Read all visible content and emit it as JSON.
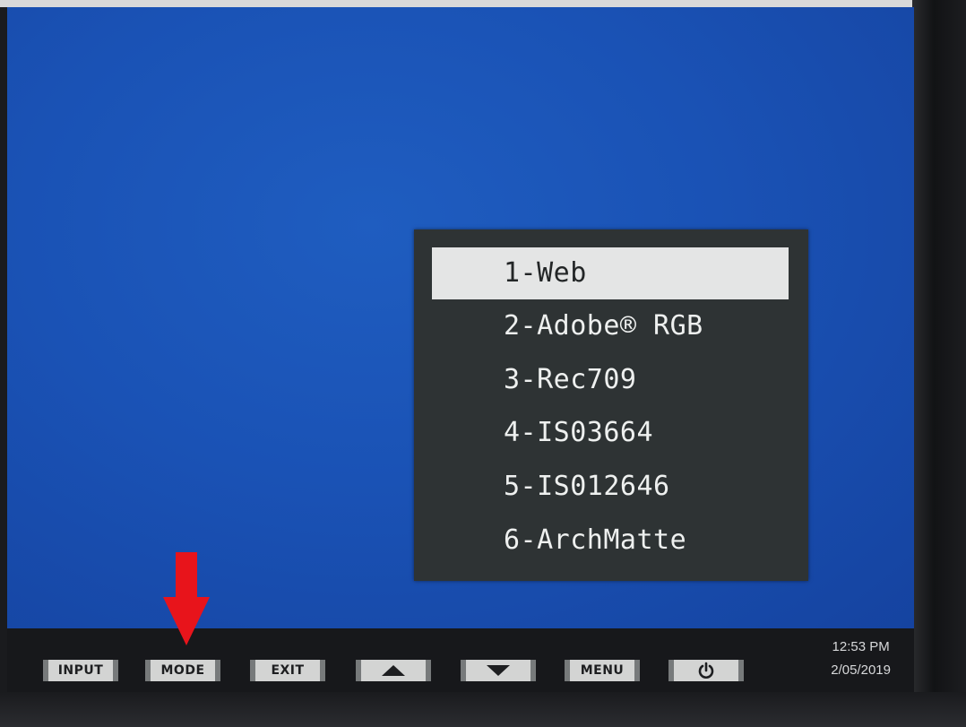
{
  "osd_menu": {
    "items": [
      {
        "label": "1-Web",
        "selected": true
      },
      {
        "label": "2-Adobe® RGB",
        "selected": false
      },
      {
        "label": "3-Rec709",
        "selected": false
      },
      {
        "label": "4-IS03664",
        "selected": false
      },
      {
        "label": "5-IS012646",
        "selected": false
      },
      {
        "label": "6-ArchMatte",
        "selected": false
      }
    ]
  },
  "bezel_buttons": {
    "input_label": "INPUT",
    "mode_label": "MODE",
    "exit_label": "EXIT",
    "up_icon": "up-arrow-icon",
    "down_icon": "down-arrow-icon",
    "menu_label": "MENU",
    "power_icon": "power-icon"
  },
  "taskbar": {
    "time": "12:53 PM",
    "date": "2/05/2019"
  },
  "annotation": {
    "arrow_color": "#e8141b",
    "points_to": "mode-button"
  },
  "colors": {
    "screen_blue": "#1a52b5",
    "osd_bg": "#2e3334",
    "osd_selected_bg": "#e4e5e5"
  }
}
